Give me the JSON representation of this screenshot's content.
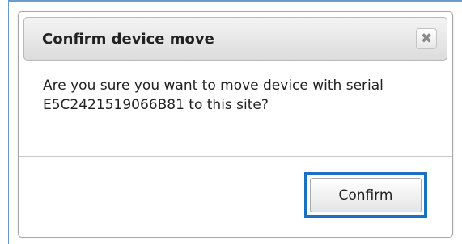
{
  "dialog": {
    "title": "Confirm device move",
    "close_symbol": "✖",
    "message": "Are you sure you want to move device with serial E5C2421519066B81 to this site?",
    "confirm_label": "Confirm"
  },
  "colors": {
    "focus_ring": "#1d6fc0",
    "page_frame": "#6a9bd0",
    "titlebar_top": "#f4f4f4",
    "titlebar_bottom": "#dcdcdc"
  },
  "icons": {
    "close": "close-icon"
  }
}
